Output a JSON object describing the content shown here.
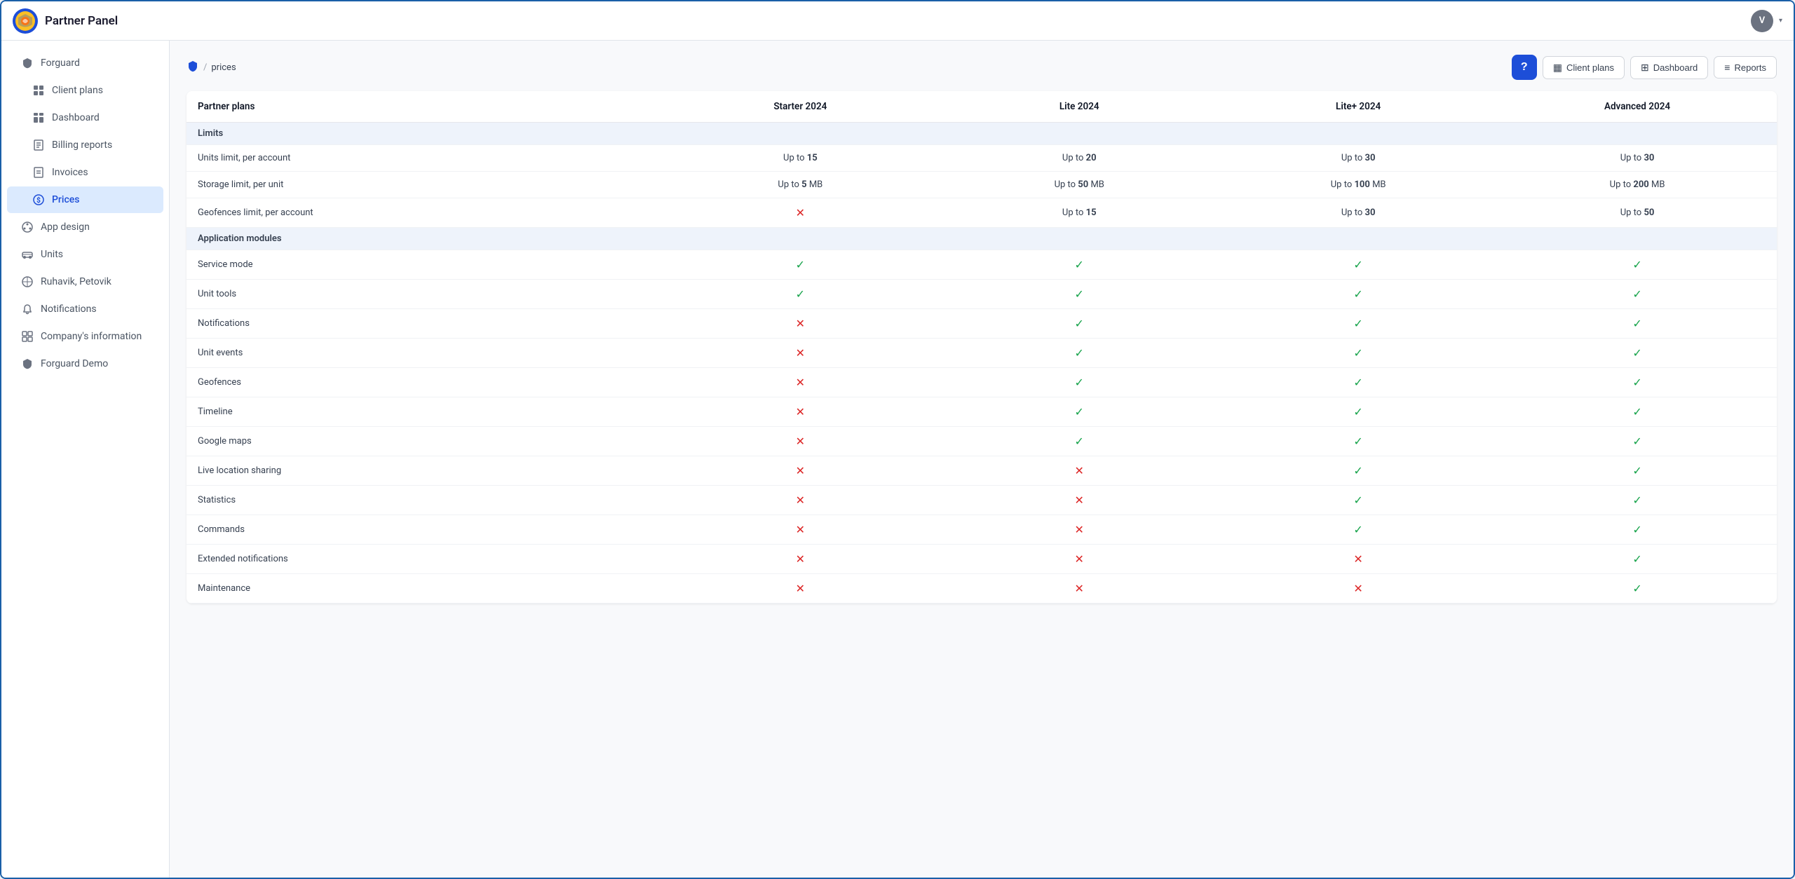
{
  "app": {
    "title": "Partner Panel",
    "avatar_letter": "V"
  },
  "sidebar": {
    "items": [
      {
        "id": "forguard",
        "label": "Forguard",
        "icon": "🛡",
        "active": false,
        "indent": false
      },
      {
        "id": "client-plans",
        "label": "Client plans",
        "icon": "▦",
        "active": false,
        "indent": true
      },
      {
        "id": "dashboard",
        "label": "Dashboard",
        "icon": "⊞",
        "active": false,
        "indent": true
      },
      {
        "id": "billing-reports",
        "label": "Billing reports",
        "icon": "≡",
        "active": false,
        "indent": true
      },
      {
        "id": "invoices",
        "label": "Invoices",
        "icon": "⊟",
        "active": false,
        "indent": true
      },
      {
        "id": "prices",
        "label": "Prices",
        "icon": "$",
        "active": true,
        "indent": true
      },
      {
        "id": "app-design",
        "label": "App design",
        "icon": "🎨",
        "active": false,
        "indent": false
      },
      {
        "id": "units",
        "label": "Units",
        "icon": "🚗",
        "active": false,
        "indent": false
      },
      {
        "id": "ruhavik",
        "label": "Ruhavik, Petovik",
        "icon": "✳",
        "active": false,
        "indent": false
      },
      {
        "id": "notifications",
        "label": "Notifications",
        "icon": "🔔",
        "active": false,
        "indent": false
      },
      {
        "id": "company-info",
        "label": "Company's information",
        "icon": "▦",
        "active": false,
        "indent": false
      },
      {
        "id": "forguard-demo",
        "label": "Forguard Demo",
        "icon": "🛡",
        "active": false,
        "indent": false
      }
    ]
  },
  "breadcrumb": {
    "root_icon": "shield",
    "separator": "/",
    "current": "prices"
  },
  "toolbar": {
    "help_label": "?",
    "client_plans_label": "Client plans",
    "dashboard_label": "Dashboard",
    "reports_label": "Reports"
  },
  "table": {
    "col_feature": "Partner plans",
    "cols": [
      "Starter 2024",
      "Lite 2024",
      "Lite+ 2024",
      "Advanced 2024"
    ],
    "sections": [
      {
        "section_label": "Limits",
        "rows": [
          {
            "feature": "Units limit, per account",
            "values": [
              "Up to <b>15</b>",
              "Up to <b>20</b>",
              "Up to <b>30</b>",
              "Up to <b>30</b>"
            ]
          },
          {
            "feature": "Storage limit, per unit",
            "values": [
              "Up to <b>5</b> MB",
              "Up to <b>50</b> MB",
              "Up to <b>100</b> MB",
              "Up to <b>200</b> MB"
            ]
          },
          {
            "feature": "Geofences limit, per account",
            "values": [
              "cross",
              "Up to <b>15</b>",
              "Up to <b>30</b>",
              "Up to <b>50</b>"
            ]
          }
        ]
      },
      {
        "section_label": "Application modules",
        "rows": [
          {
            "feature": "Service mode",
            "values": [
              "check",
              "check",
              "check",
              "check"
            ]
          },
          {
            "feature": "Unit tools",
            "values": [
              "check",
              "check",
              "check",
              "check"
            ]
          },
          {
            "feature": "Notifications",
            "values": [
              "cross",
              "check",
              "check",
              "check"
            ]
          },
          {
            "feature": "Unit events",
            "values": [
              "cross",
              "check",
              "check",
              "check"
            ]
          },
          {
            "feature": "Geofences",
            "values": [
              "cross",
              "check",
              "check",
              "check"
            ]
          },
          {
            "feature": "Timeline",
            "values": [
              "cross",
              "check",
              "check",
              "check"
            ]
          },
          {
            "feature": "Google maps",
            "values": [
              "cross",
              "check",
              "check",
              "check"
            ]
          },
          {
            "feature": "Live location sharing",
            "values": [
              "cross",
              "cross",
              "check",
              "check"
            ]
          },
          {
            "feature": "Statistics",
            "values": [
              "cross",
              "cross",
              "check",
              "check"
            ]
          },
          {
            "feature": "Commands",
            "values": [
              "cross",
              "cross",
              "check",
              "check"
            ]
          },
          {
            "feature": "Extended notifications",
            "values": [
              "cross",
              "cross",
              "cross",
              "check"
            ]
          },
          {
            "feature": "Maintenance",
            "values": [
              "cross",
              "cross",
              "cross",
              "check"
            ]
          }
        ]
      }
    ]
  }
}
